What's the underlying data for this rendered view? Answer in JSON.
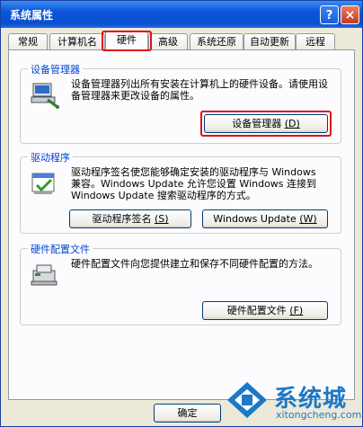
{
  "window": {
    "title": "系统属性",
    "help_label": "?",
    "close_label": "×"
  },
  "tabs": [
    {
      "label": "常规"
    },
    {
      "label": "计算机名"
    },
    {
      "label": "硬件"
    },
    {
      "label": "高级"
    },
    {
      "label": "系统还原"
    },
    {
      "label": "自动更新"
    },
    {
      "label": "远程"
    }
  ],
  "active_tab": "硬件",
  "groups": {
    "device_manager": {
      "title": "设备管理器",
      "description": "设备管理器列出所有安装在计算机上的硬件设备。请使用设备管理器来更改设备的属性。",
      "button_label": "设备管理器",
      "button_mnemonic": "(D)"
    },
    "drivers": {
      "title": "驱动程序",
      "description_lines": [
        "驱动程序签名使您能够确定安装的驱动程序与 Windows",
        "兼容。Windows Update 允许您设置 Windows 连接到",
        "Windows Update 搜索驱动程序的方式。"
      ],
      "signing_button_label": "驱动程序签名",
      "signing_button_mnemonic": "(S)",
      "update_button_label": "Windows Update",
      "update_button_mnemonic": "(W)"
    },
    "hardware_profiles": {
      "title": "硬件配置文件",
      "description": "硬件配置文件向您提供建立和保存不同硬件配置的方法。",
      "button_label": "硬件配置文件",
      "button_mnemonic": "(F)"
    }
  },
  "footer": {
    "ok_label": "确定"
  },
  "watermark": {
    "brand": "系统城",
    "site": "xitongcheng.com"
  },
  "colors": {
    "titlebar": "#0a55d8",
    "highlight": "#e0101a",
    "group_title": "#0046d5",
    "face": "#ece9d8"
  }
}
